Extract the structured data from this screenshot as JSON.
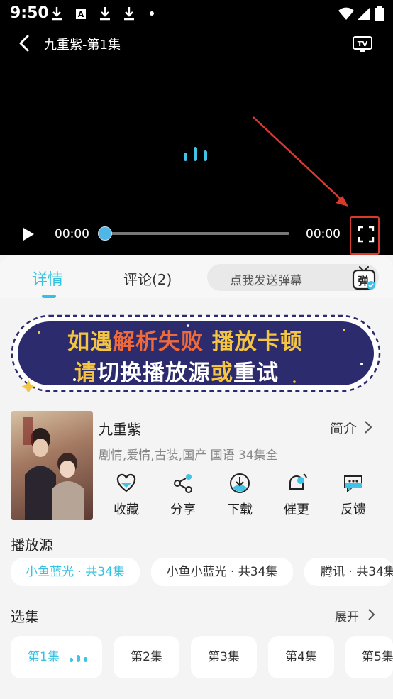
{
  "status_bar": {
    "time": "9:50"
  },
  "player": {
    "title": "九重紫-第1集",
    "current_time": "00:00",
    "duration": "00:00",
    "progress": 0
  },
  "tabs": {
    "details": "详情",
    "comments": "评论(2)"
  },
  "danmaku": {
    "placeholder": "点我发送弹幕",
    "icon_label": "弹"
  },
  "banner": {
    "line1": [
      "如遇",
      "解析失败",
      " 播放卡顿"
    ],
    "line2": [
      "请",
      "切换播放源",
      "或",
      "重试"
    ]
  },
  "movie": {
    "title": "九重紫",
    "intro_label": "简介",
    "tags": "剧情,爱情,古装,国产 国语 34集全"
  },
  "actions": [
    {
      "label": "收藏",
      "icon": "heart-icon"
    },
    {
      "label": "分享",
      "icon": "share-icon"
    },
    {
      "label": "下载",
      "icon": "download-icon"
    },
    {
      "label": "催更",
      "icon": "bell-icon"
    },
    {
      "label": "反馈",
      "icon": "feedback-icon"
    }
  ],
  "sources": {
    "title": "播放源",
    "items": [
      {
        "label": "小鱼蓝光 · 共34集",
        "active": true
      },
      {
        "label": "小鱼小蓝光 · 共34集",
        "active": false
      },
      {
        "label": "腾讯 · 共34集",
        "active": false
      }
    ]
  },
  "episodes": {
    "title": "选集",
    "expand_label": "展开",
    "items": [
      "第1集",
      "第2集",
      "第3集",
      "第4集",
      "第5集"
    ]
  },
  "colors": {
    "accent": "#34c2e0",
    "highlight_box": "#d83a2d",
    "banner_yellow": "#f4c542",
    "banner_red": "#ef6a3a"
  }
}
